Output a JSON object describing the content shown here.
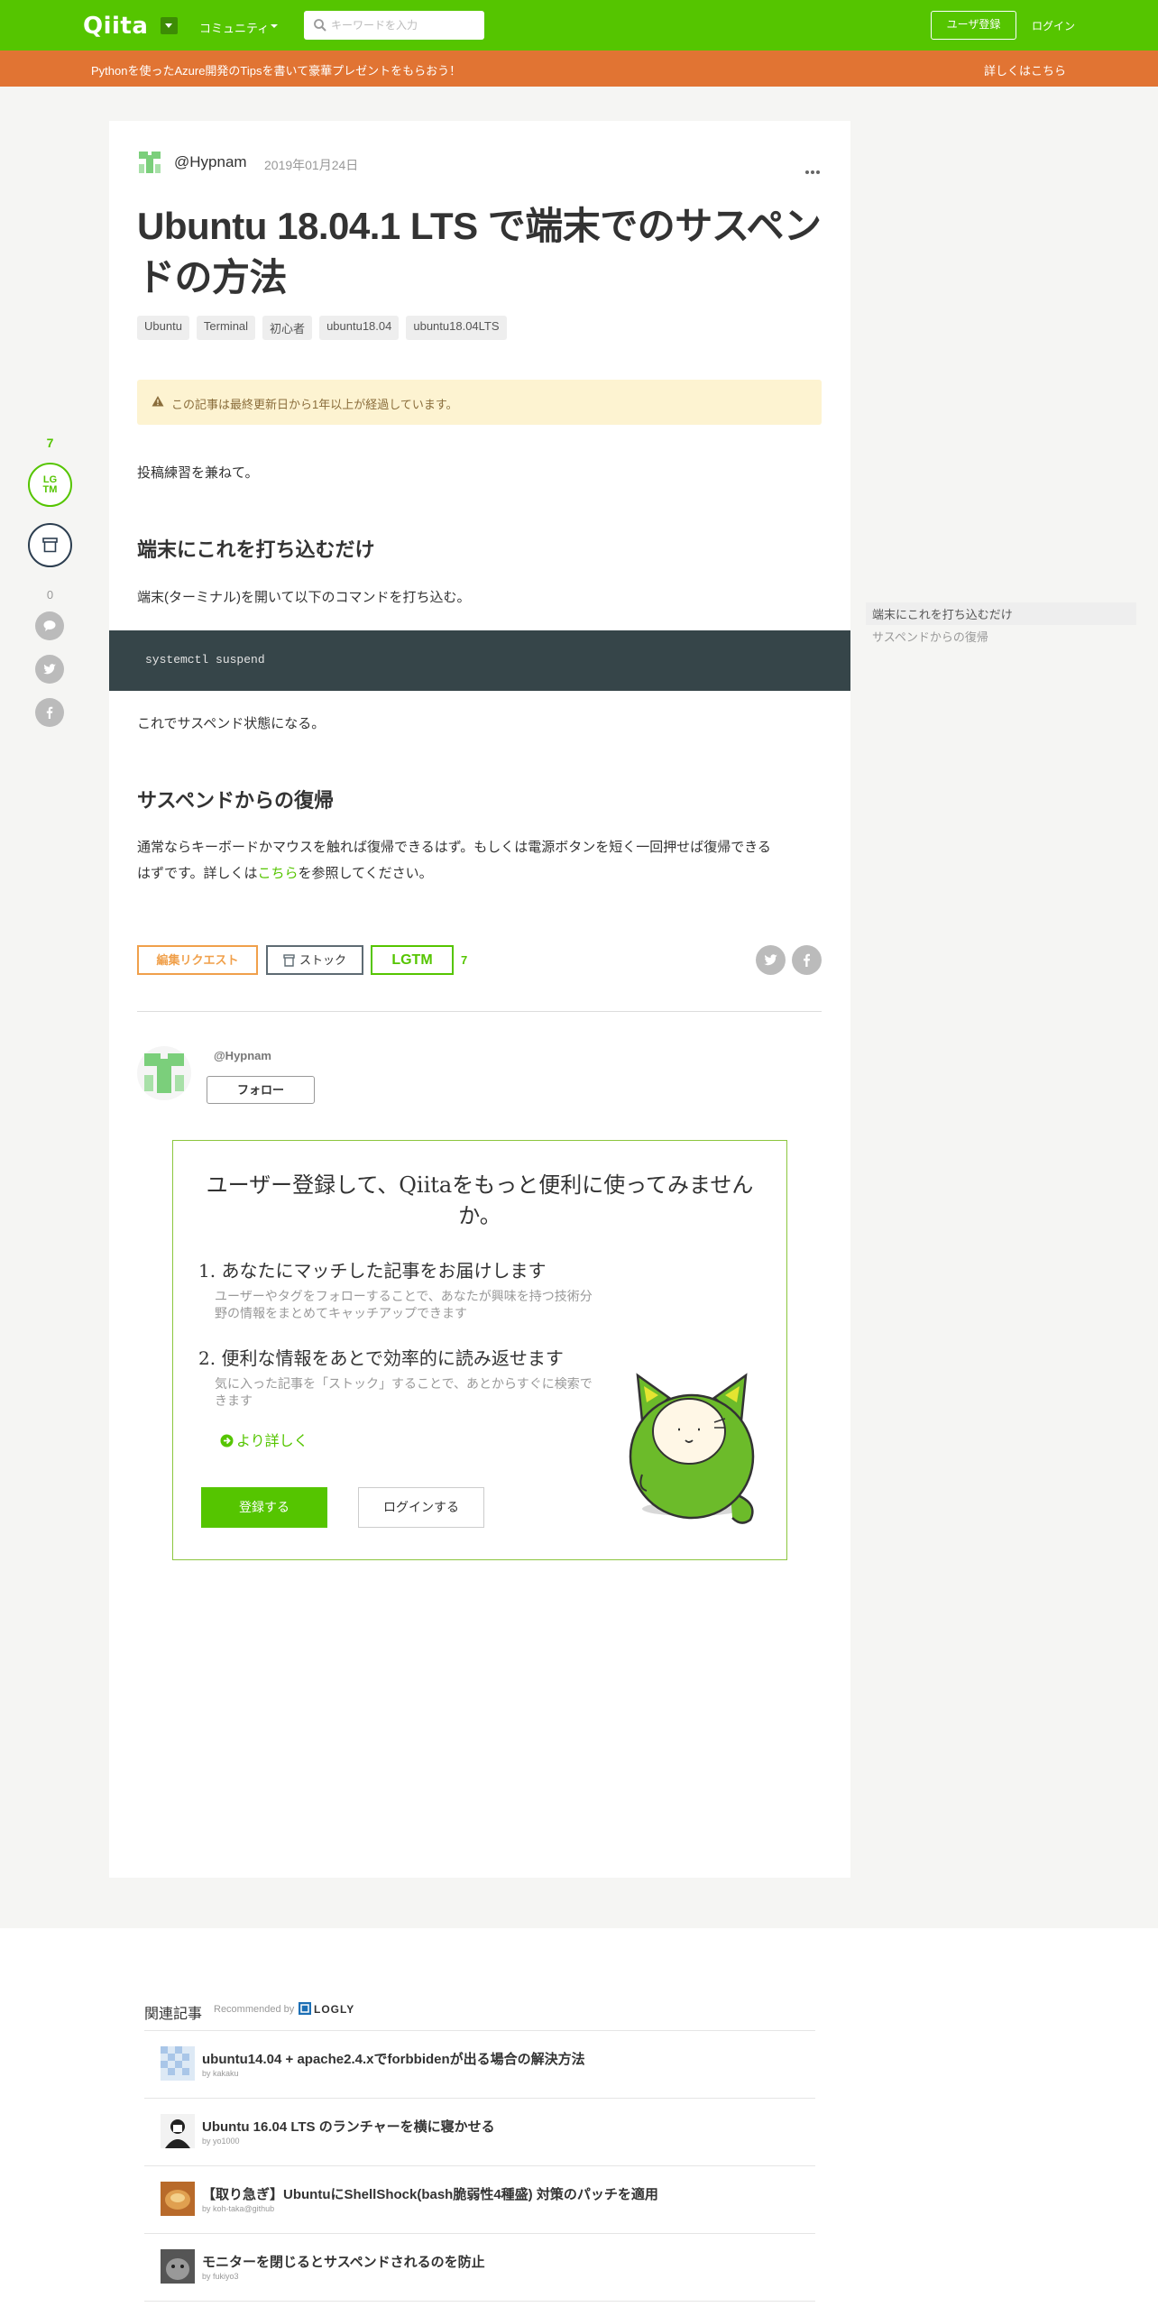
{
  "header": {
    "logo": "Qiita",
    "community_label": "コミュニティ",
    "search_placeholder": "キーワードを入力",
    "signup_label": "ユーザ登録",
    "login_label": "ログイン"
  },
  "banner": {
    "text": "Pythonを使ったAzure開発のTipsを書いて豪華プレゼントをもらおう！",
    "link": "詳しくはこちら"
  },
  "sidebar": {
    "lgtm_count": "7",
    "lgtm_label_1": "LG",
    "lgtm_label_2": "TM",
    "comment_count": "0"
  },
  "article": {
    "author": "@Hypnam",
    "date": "2019年01月24日",
    "title": "Ubuntu 18.04.1 LTS で端末でのサスペンドの方法",
    "tags": [
      "Ubuntu",
      "Terminal",
      "初心者",
      "ubuntu18.04",
      "ubuntu18.04LTS"
    ],
    "alert": "この記事は最終更新日から1年以上が経過しています。",
    "intro": "投稿練習を兼ねて。",
    "h2_1": "端末にこれを打ち込むだけ",
    "p2": "端末(ターミナル)を開いて以下のコマンドを打ち込む。",
    "code": "systemctl suspend",
    "p3": "これでサスペンド状態になる。",
    "h2_2": "サスペンドからの復帰",
    "p4_part1": "通常ならキーボードかマウスを触れば復帰できるはず。もしくは電源ボタンを短く一回押せば復帰できる",
    "p4_part2": "はずです。詳しくは",
    "p4_link": "こちら",
    "p4_part3": "を参照してください。"
  },
  "actions": {
    "edit_request": "編集リクエスト",
    "stock": "ストック",
    "lgtm": "LGTM",
    "lgtm_count": "7"
  },
  "author_box": {
    "handle": "@Hypnam",
    "follow": "フォロー"
  },
  "signup_box": {
    "title": "ユーザー登録して、Qiitaをもっと便利に使ってみませんか。",
    "item1_title": "1. あなたにマッチした記事をお届けします",
    "item1_desc": "ユーザーやタグをフォローすることで、あなたが興味を持つ技術分野の情報をまとめてキャッチアップできます",
    "item2_title": "2. 便利な情報をあとで効率的に読み返せます",
    "item2_desc": "気に入った記事を「ストック」することで、あとからすぐに検索できます",
    "more": "より詳しく",
    "register": "登録する",
    "login": "ログインする"
  },
  "toc": {
    "items": [
      "端末にこれを打ち込むだけ",
      "サスペンドからの復帰"
    ]
  },
  "related": {
    "header": "関連記事",
    "recommended": "Recommended by",
    "logly": "LOGLY",
    "items": [
      {
        "title": "ubuntu14.04 + apache2.4.xでforbbidenが出る場合の解決方法",
        "by": "by kakaku"
      },
      {
        "title": "Ubuntu 16.04 LTS のランチャーを横に寝かせる",
        "by": "by yo1000"
      },
      {
        "title": "【取り急ぎ】UbuntuにShellShock(bash脆弱性4種盛) 対策のパッチを適用",
        "by": "by koh-taka@github"
      },
      {
        "title": "モニターを閉じるとサスペンドされるのを防止",
        "by": "by fukiyo3"
      }
    ]
  },
  "colors": {
    "brand": "#55c500",
    "banner": "#e17433",
    "code_bg": "#364549"
  }
}
